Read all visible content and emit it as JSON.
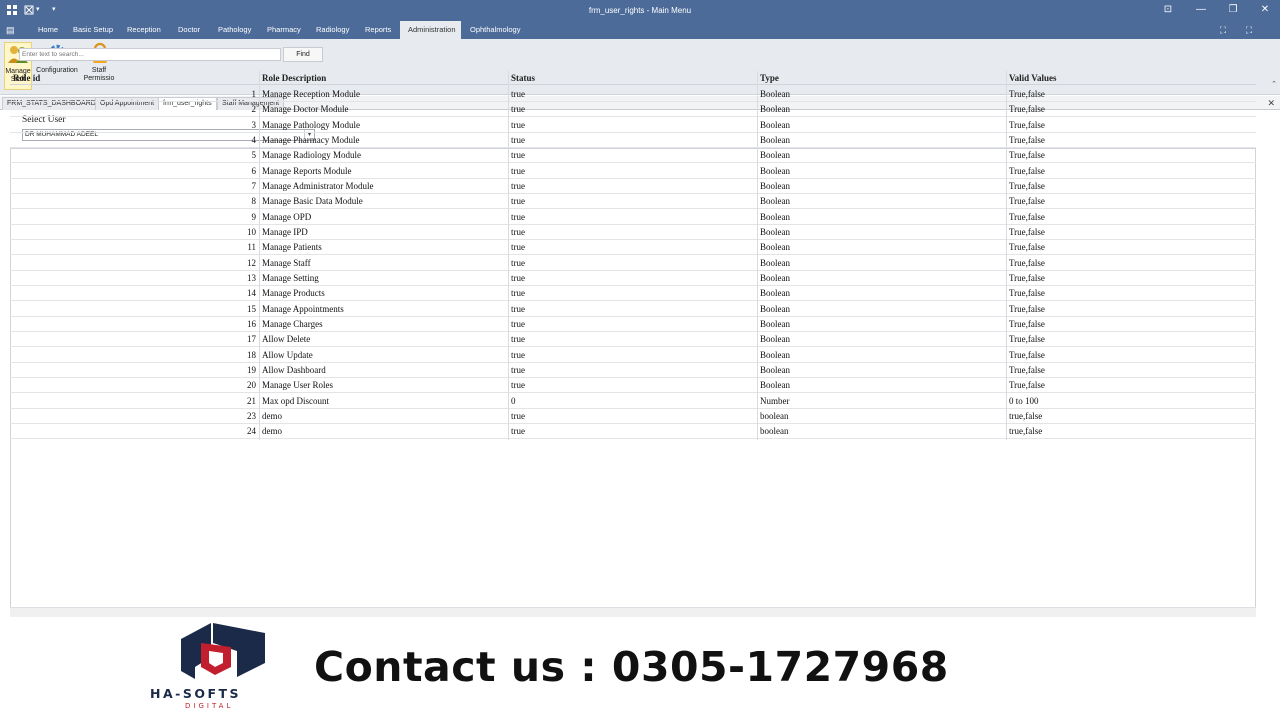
{
  "window": {
    "title": "frm_user_rights - Main Menu"
  },
  "menu_tabs": [
    "Home",
    "Basic Setup",
    "Reception",
    "Doctor",
    "Pathology",
    "Pharmacy",
    "Radiology",
    "Reports",
    "Administration",
    "Ophthalmology"
  ],
  "ribbon": {
    "manage_staff": "Manage Staff",
    "configuration": "Configuration",
    "staff_permission": "Staff Permissio"
  },
  "doc_tabs": [
    "FRM_STATS_DASHBOARD",
    "Opd Appointment",
    "frm_user_rights",
    "Staff Management"
  ],
  "form": {
    "select_label": "Select User",
    "selected_user": "DR MUHAMMAD ADEEL",
    "search_placeholder": "Enter text to search...",
    "find_label": "Find"
  },
  "grid": {
    "columns": [
      "Role id",
      "Role Description",
      "Status",
      "Type",
      "Valid Values"
    ],
    "rows": [
      [
        "1",
        "Manage Reception Module",
        "true",
        "Boolean",
        "True,false"
      ],
      [
        "2",
        "Manage Doctor Module",
        "true",
        "Boolean",
        "True,false"
      ],
      [
        "3",
        "Manage Pathology Module",
        "true",
        "Boolean",
        "True,false"
      ],
      [
        "4",
        "Manage Pharmacy Module",
        "true",
        "Boolean",
        "True,false"
      ],
      [
        "5",
        "Manage Radiology Module",
        "true",
        "Boolean",
        "True,false"
      ],
      [
        "6",
        "Manage Reports Module",
        "true",
        "Boolean",
        "True,false"
      ],
      [
        "7",
        "Manage Administrator Module",
        "true",
        "Boolean",
        "True,false"
      ],
      [
        "8",
        "Manage Basic Data Module",
        "true",
        "Boolean",
        "True,false"
      ],
      [
        "9",
        "Manage OPD",
        "true",
        "Boolean",
        "True,false"
      ],
      [
        "10",
        "Manage IPD",
        "true",
        "Boolean",
        "True,false"
      ],
      [
        "11",
        "Manage Patients",
        "true",
        "Boolean",
        "True,false"
      ],
      [
        "12",
        "Manage Staff",
        "true",
        "Boolean",
        "True,false"
      ],
      [
        "13",
        "Manage Setting",
        "true",
        "Boolean",
        "True,false"
      ],
      [
        "14",
        "Manage Products",
        "true",
        "Boolean",
        "True,false"
      ],
      [
        "15",
        "Manage Appointments",
        "true",
        "Boolean",
        "True,false"
      ],
      [
        "16",
        "Manage Charges",
        "true",
        "Boolean",
        "True,false"
      ],
      [
        "17",
        "Allow Delete",
        "true",
        "Boolean",
        "True,false"
      ],
      [
        "18",
        "Allow Update",
        "true",
        "Boolean",
        "True,false"
      ],
      [
        "19",
        "Allow Dashboard",
        "true",
        "Boolean",
        "True,false"
      ],
      [
        "20",
        "Manage User Roles",
        "true",
        "Boolean",
        "True,false"
      ],
      [
        "21",
        "Max opd Discount",
        "0",
        "Number",
        "0 to 100"
      ],
      [
        "23",
        "demo",
        "true",
        "boolean",
        "true,false"
      ],
      [
        "24",
        "demo",
        "true",
        "boolean",
        "true,false"
      ]
    ]
  },
  "footer": {
    "brand": "HA-SOFTS",
    "brand_sub": "DIGITAL",
    "contact": "Contact us : 0305-1727968"
  },
  "colors": {
    "titlebar": "#4c6b99",
    "ribbon": "#e7eaee",
    "brand_navy": "#1c2a4a",
    "brand_red": "#c11e2e"
  },
  "icons": [
    "app-icon",
    "manage-staff-icon",
    "gear-icon",
    "lock-icon",
    "close-icon",
    "minimize-icon",
    "maximize-icon",
    "restore-icon",
    "chevron-down-icon"
  ]
}
